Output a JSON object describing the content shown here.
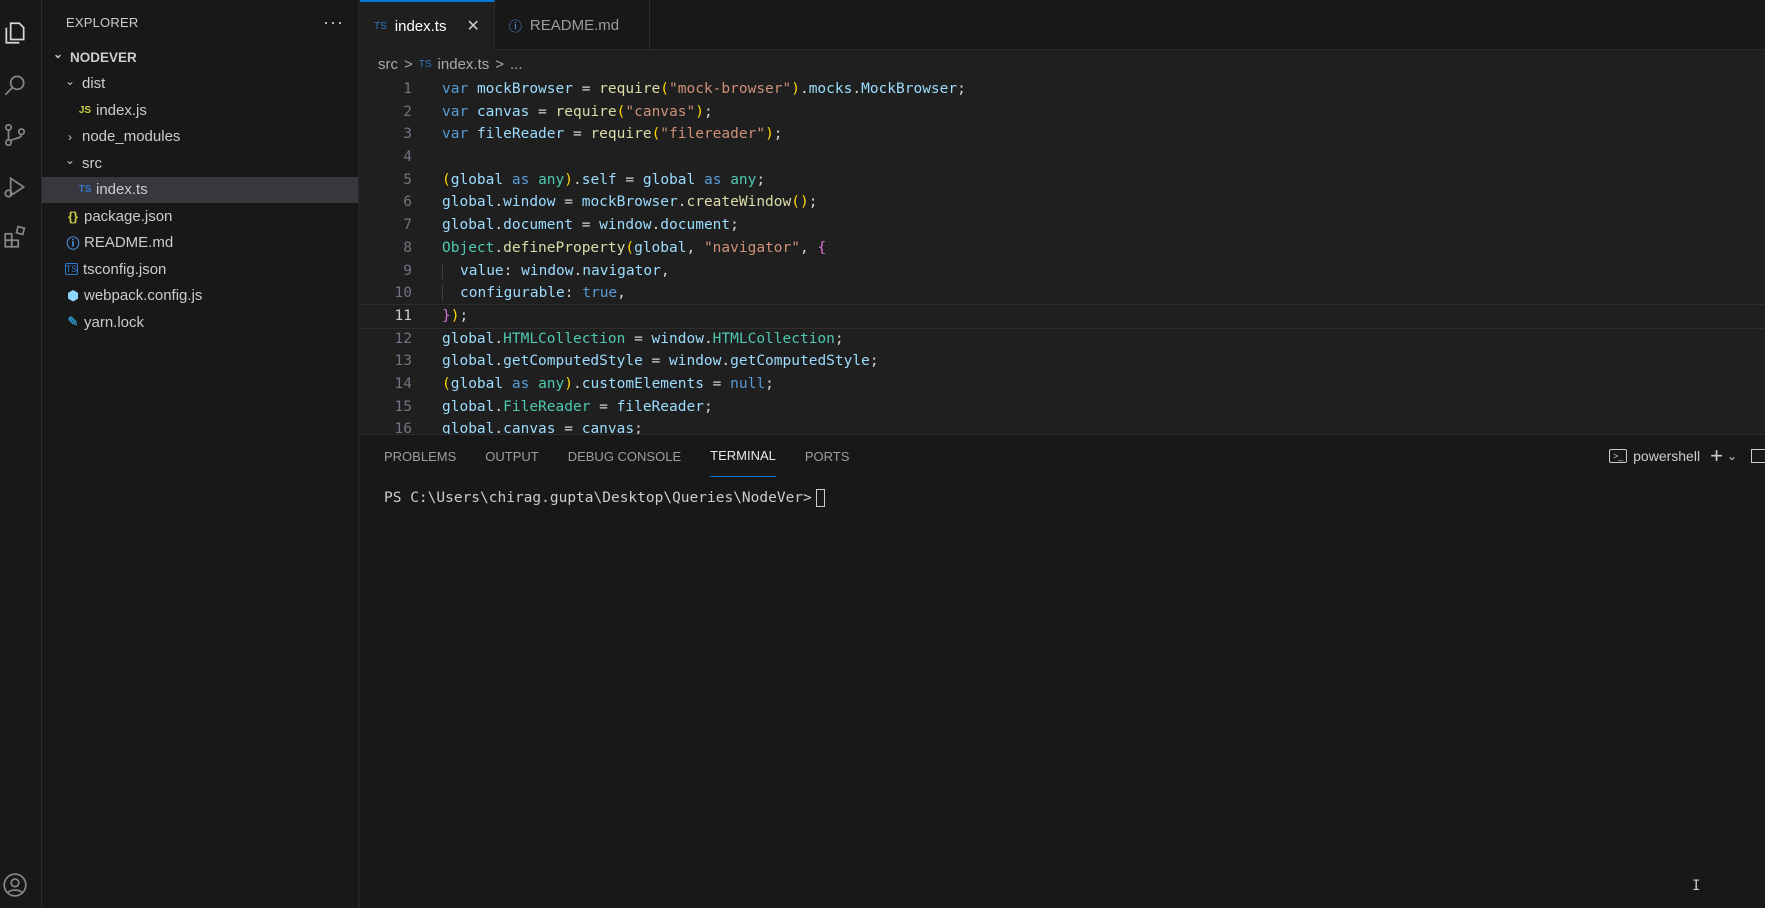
{
  "sidebar": {
    "title": "EXPLORER",
    "more": "···",
    "tree": [
      {
        "label": "NODEVER",
        "type": "root",
        "chevron": "⌄"
      },
      {
        "label": "dist",
        "type": "folder",
        "chevron": "⌄",
        "indent": 1
      },
      {
        "label": "index.js",
        "type": "js",
        "badge": "JS",
        "indent": 2
      },
      {
        "label": "node_modules",
        "type": "folder",
        "chevron": "›",
        "indent": 1
      },
      {
        "label": "src",
        "type": "folder",
        "chevron": "⌄",
        "indent": 1
      },
      {
        "label": "index.ts",
        "type": "ts",
        "badge": "TS",
        "indent": 2,
        "selected": true
      },
      {
        "label": "package.json",
        "type": "json",
        "badge": "{}",
        "indent": 1
      },
      {
        "label": "README.md",
        "type": "info",
        "badge": "ⓘ",
        "indent": 1
      },
      {
        "label": "tsconfig.json",
        "type": "tsconfig",
        "badge": "TS",
        "indent": 1
      },
      {
        "label": "webpack.config.js",
        "type": "webpack",
        "badge": "⬢",
        "indent": 1
      },
      {
        "label": "yarn.lock",
        "type": "yarn",
        "badge": "🧶",
        "indent": 1
      }
    ]
  },
  "tabs": [
    {
      "badge": "TS",
      "label": "index.ts",
      "close": "✕",
      "active": true
    },
    {
      "badge": "ⓘ",
      "label": "README.md",
      "active": false
    }
  ],
  "breadcrumb": {
    "folder": "src",
    "sep": ">",
    "badge": "TS",
    "file": "index.ts",
    "rest": "..."
  },
  "current_line": 11,
  "code_lines": [
    "var mockBrowser = require(\"mock-browser\").mocks.MockBrowser;",
    "var canvas = require(\"canvas\");",
    "var fileReader = require(\"filereader\");",
    "",
    "(global as any).self = global as any;",
    "global.window = mockBrowser.createWindow();",
    "global.document = window.document;",
    "Object.defineProperty(global, \"navigator\", {",
    "  value: window.navigator,",
    "  configurable: true,",
    "});",
    "global.HTMLCollection = window.HTMLCollection;",
    "global.getComputedStyle = window.getComputedStyle;",
    "(global as any).customElements = null;",
    "global.FileReader = fileReader;",
    "global.canvas = canvas;"
  ],
  "panel": {
    "tabs": [
      "PROBLEMS",
      "OUTPUT",
      "DEBUG CONSOLE",
      "TERMINAL",
      "PORTS"
    ],
    "active_tab": "TERMINAL",
    "shell": "powershell",
    "add": "+",
    "dropdown": "⌄"
  },
  "terminal": {
    "prompt": "PS C:\\Users\\chirag.gupta\\Desktop\\Queries\\NodeVer>"
  },
  "colors": {
    "accent": "#0078d4",
    "ts": "#3178c6",
    "js": "#cbcb41"
  }
}
